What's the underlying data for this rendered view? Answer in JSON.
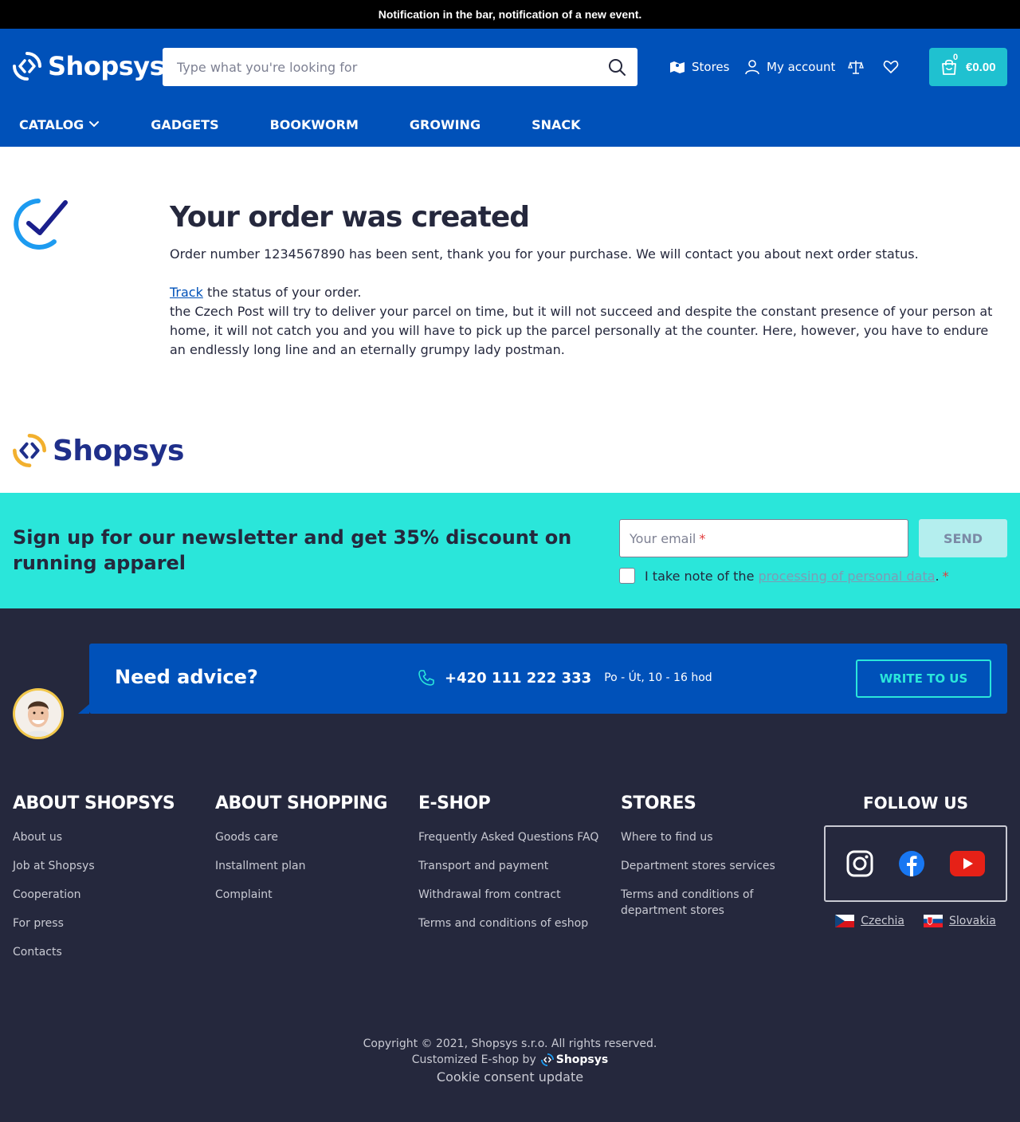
{
  "notification": "Notification in the bar, notification of a new event.",
  "header": {
    "logo_text": "Shopsys",
    "search_placeholder": "Type what you're looking for",
    "stores_label": "Stores",
    "account_label": "My account",
    "cart": {
      "count": "0",
      "total": "€0.00"
    }
  },
  "nav": [
    {
      "label": "Catalog"
    },
    {
      "label": "Gadgets"
    },
    {
      "label": "Bookworm"
    },
    {
      "label": "Growing"
    },
    {
      "label": "Snack"
    }
  ],
  "order": {
    "title": "Your order was created",
    "message": "Order number 1234567890 has been sent, thank you for your purchase. We will contact you about next order status.",
    "track_link": "Track",
    "track_rest": " the status of your order.",
    "shipping_note": "the Czech Post will try to deliver your parcel on time, but it will not succeed and despite the constant presence of your person at home, it will not catch you and you will have to pick up the parcel personally at the counter. Here, however, you have to endure an endlessly long line and an eternally grumpy lady postman."
  },
  "footer_logo_text": "Shopsys",
  "newsletter": {
    "title": "Sign up for our newsletter and get 35% discount on running apparel",
    "email_placeholder": "Your email",
    "required_mark": "*",
    "send_label": "SEND",
    "consent_prefix": "I take note of the ",
    "consent_link": "processing of personal data",
    "consent_suffix": "."
  },
  "advice": {
    "title": "Need advice?",
    "phone": "+420 111 222 333",
    "hours": "Po - Út, 10 - 16 hod",
    "write_label": "WRITE TO US"
  },
  "footer_columns": [
    {
      "title": "About Shopsys",
      "links": [
        "About us",
        "Job at Shopsys",
        "Cooperation",
        "For press",
        "Contacts"
      ]
    },
    {
      "title": "About shopping",
      "links": [
        "Goods care",
        "Installment plan",
        "Complaint"
      ]
    },
    {
      "title": "E-shop",
      "links": [
        "Frequently Asked Questions FAQ",
        "Transport and payment",
        "Withdrawal from contract",
        "Terms and conditions of eshop"
      ]
    },
    {
      "title": "Stores",
      "links": [
        "Where to find us",
        "Department stores services",
        "Terms and conditions of department stores"
      ]
    }
  ],
  "follow": {
    "title": "FOLLOW US",
    "languages": [
      "Czechia",
      "Slovakia"
    ]
  },
  "copyright": {
    "line1": "Copyright © 2021, Shopsys s.r.o. All rights reserved.",
    "customized": "Customized E-shop by",
    "brand": "Shopsys",
    "cookie": "Cookie consent update"
  },
  "colors": {
    "brand_blue": "#0051b9",
    "cart_cyan": "#1fc1d0",
    "newsletter_bg": "#2ae6da",
    "footer_bg": "#25283d"
  }
}
